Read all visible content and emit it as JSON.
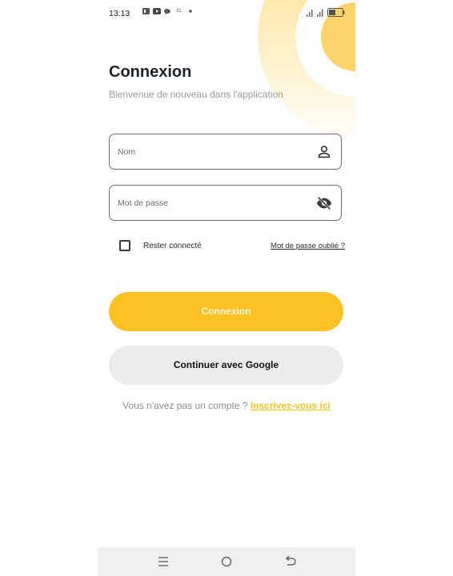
{
  "status_bar": {
    "time": "13:13",
    "icons": [
      "sim-icon",
      "youtube-icon",
      "chat-icon",
      "calendar-icon",
      "dot-icon",
      "signal-icon",
      "battery-icon"
    ],
    "calendar_day": "31",
    "battery_level": "38"
  },
  "header": {
    "title": "Connexion",
    "subtitle": "Bienvenue de nouveau dans l'application"
  },
  "form": {
    "name_placeholder": "Nom",
    "password_placeholder": "Mot de passe",
    "remember_label": "Rester connecté",
    "remember_checked": false,
    "forgot_link": "Mot de passe oublié ?"
  },
  "actions": {
    "login_label": "Connexion",
    "google_label": "Continuer avec Google",
    "signup_prompt": "Vous n'avez pas un compte ? ",
    "signup_link": "Inscrivez-vous ici"
  },
  "colors": {
    "accent": "#fcc223",
    "secondary_button": "#ececec",
    "title_text": "#1f2328",
    "muted_text": "#9a9a9a"
  }
}
